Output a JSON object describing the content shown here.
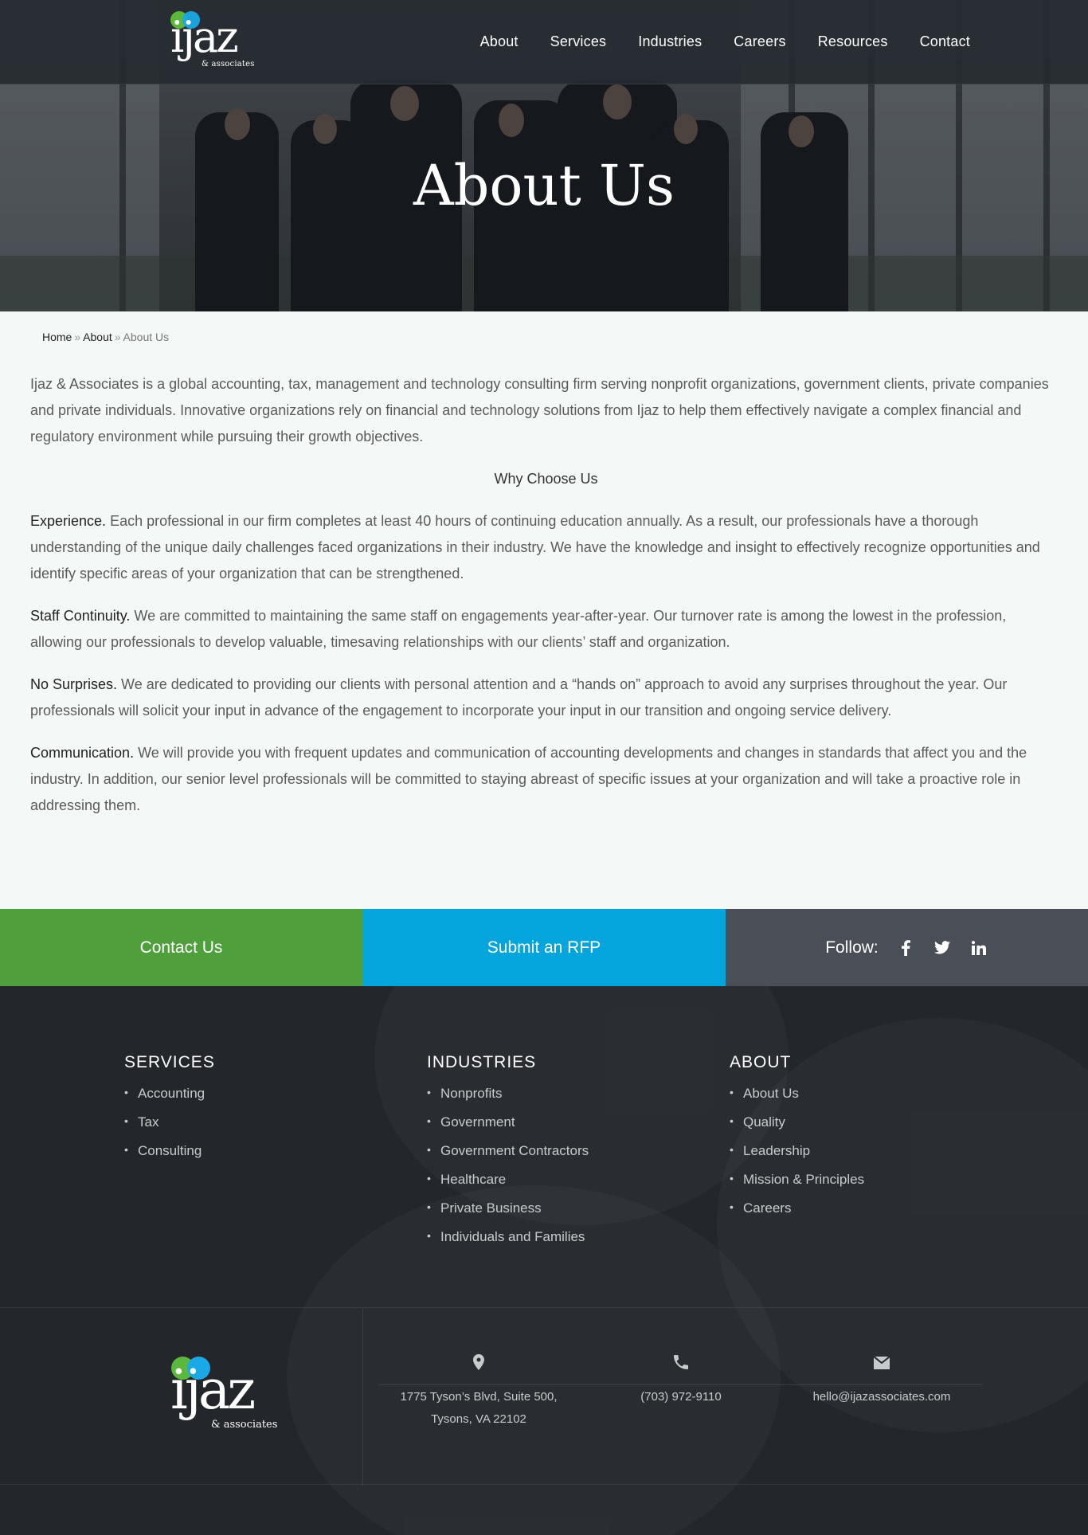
{
  "nav": {
    "logo_word": "ijaz",
    "logo_sub": "& associates",
    "items": [
      "About",
      "Services",
      "Industries",
      "Careers",
      "Resources",
      "Contact"
    ]
  },
  "hero": {
    "title": "About Us"
  },
  "breadcrumb": {
    "home": "Home",
    "about": "About",
    "current": "About Us",
    "sep": "»"
  },
  "body": {
    "intro": "Ijaz & Associates is a global accounting, tax, management and technology consulting firm serving nonprofit organizations, government clients, private companies and private individuals. Innovative organizations rely on financial and technology solutions from Ijaz to help them effectively navigate a complex financial and regulatory environment while pursuing their growth objectives.",
    "why_heading": "Why Choose Us",
    "points": [
      {
        "lead": "Experience.",
        "text": " Each professional in our firm completes at least 40 hours of continuing education annually. As a result, our professionals have a thorough understanding of the unique daily challenges faced organizations in their industry. We have the knowledge and insight to effectively recognize opportunities and identify specific areas of your organization that can be strengthened."
      },
      {
        "lead": "Staff Continuity.",
        "text": " We are committed to maintaining the same staff on engagements year-after-year. Our turnover rate is among the lowest in the profession, allowing our professionals to develop valuable, timesaving relationships with our clients’ staff and organization."
      },
      {
        "lead": "No Surprises.",
        "text": " We are dedicated to providing our clients with personal attention and a “hands on” approach to avoid any surprises throughout the year. Our professionals will solicit your input in advance of the engagement to incorporate your input in our transition and ongoing service delivery."
      },
      {
        "lead": "Communication.",
        "text": " We will provide you with frequent updates and communication of accounting developments and changes in standards that affect you and the industry. In addition, our senior level professionals will be committed to staying abreast of specific issues at your organization and will take a proactive role in addressing them."
      }
    ]
  },
  "cta": {
    "contact": "Contact Us",
    "rfp": "Submit an RFP",
    "follow": "Follow:",
    "social_icons": [
      "facebook-icon",
      "twitter-icon",
      "linkedin-icon"
    ],
    "colors": {
      "contact": "#4fa03c",
      "rfp": "#04a5dc",
      "follow": "#4a4e56"
    }
  },
  "footer": {
    "services": {
      "title": "SERVICES",
      "items": [
        "Accounting",
        "Tax",
        "Consulting"
      ]
    },
    "industries": {
      "title": "INDUSTRIES",
      "items": [
        "Nonprofits",
        "Government",
        "Government Contractors",
        "Healthcare",
        "Private Business",
        "Individuals and Families"
      ]
    },
    "about": {
      "title": "ABOUT",
      "items": [
        "About Us",
        "Quality",
        "Leadership",
        "Mission & Principles",
        "Careers"
      ]
    },
    "address_line1": "1775 Tyson’s Blvd, Suite 500,",
    "address_line2": "Tysons, VA 22102",
    "phone": "(703) 972-9110",
    "email": "hello@ijazassociates.com"
  }
}
